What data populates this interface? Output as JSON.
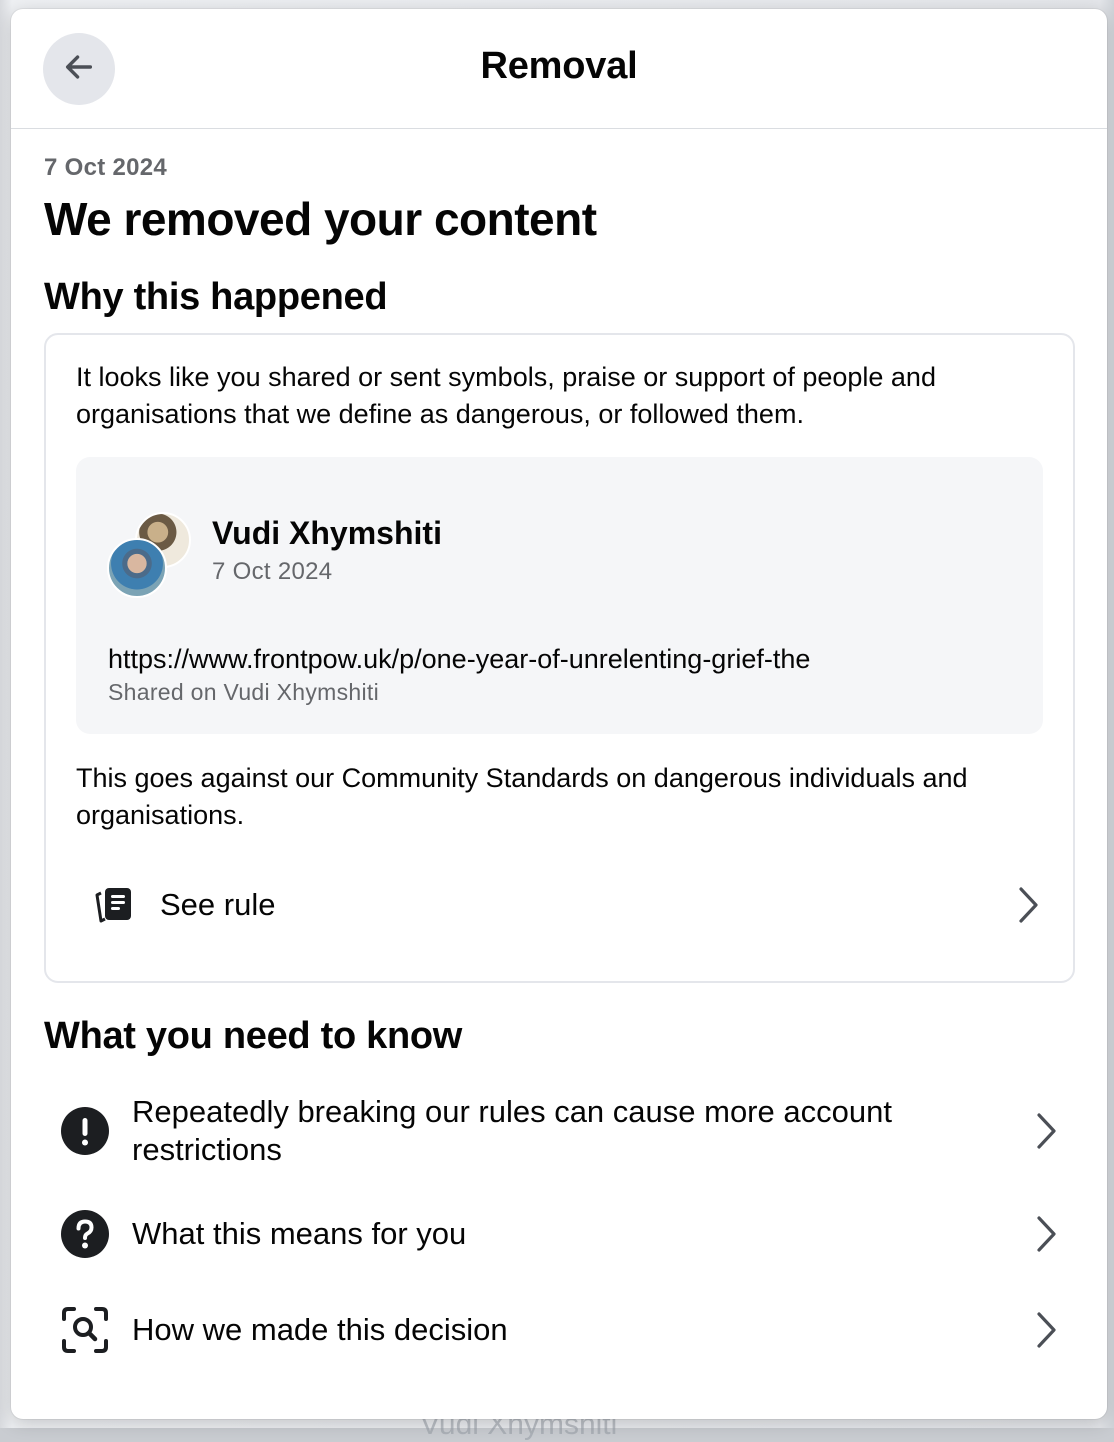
{
  "dialog": {
    "title": "Removal",
    "back_icon": "arrow-left-icon"
  },
  "notice": {
    "date": "7 Oct 2024",
    "heading": "We removed your content"
  },
  "why": {
    "heading": "Why this happened",
    "intro": "It looks like you shared or sent symbols, praise or support of people and organisations that we define as dangerous, or followed them.",
    "post": {
      "author": "Vudi Xhymshiti",
      "date": "7 Oct 2024",
      "link": "https://www.frontpow.uk/p/one-year-of-unrelenting-grief-the",
      "shared_on": "Shared on Vudi Xhymshiti"
    },
    "standards_text": "This goes against our Community Standards on dangerous individuals and organisations.",
    "see_rule_label": "See rule",
    "see_rule_icon": "rulebook-icon"
  },
  "know": {
    "heading": "What you need to know",
    "items": [
      {
        "label": "Repeatedly breaking our rules can cause more account restrictions",
        "icon": "exclamation-circle-icon"
      },
      {
        "label": "What this means for you",
        "icon": "question-circle-icon"
      },
      {
        "label": "How we made this decision",
        "icon": "magnify-scan-icon"
      }
    ]
  },
  "colors": {
    "primary_text": "#050505",
    "secondary_text": "#65676b",
    "divider": "#dadde1",
    "post_bg": "#f5f6f8",
    "back_button_bg": "#e4e6eb"
  }
}
